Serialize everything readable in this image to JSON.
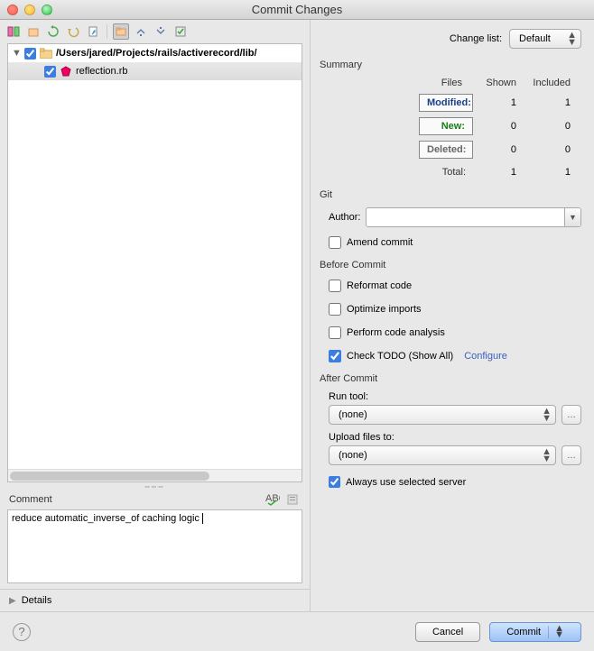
{
  "window": {
    "title": "Commit Changes"
  },
  "changeList": {
    "label": "Change list:",
    "value": "Default"
  },
  "tree": {
    "rootPath": "/Users/jared/Projects/rails/activerecord/lib/",
    "file": "reflection.rb"
  },
  "comment": {
    "label": "Comment",
    "text": "reduce automatic_inverse_of caching logic"
  },
  "summary": {
    "title": "Summary",
    "headers": {
      "files": "Files",
      "shown": "Shown",
      "included": "Included"
    },
    "rows": {
      "modified": {
        "label": "Modified:",
        "shown": "1",
        "included": "1"
      },
      "new": {
        "label": "New:",
        "shown": "0",
        "included": "0"
      },
      "deleted": {
        "label": "Deleted:",
        "shown": "0",
        "included": "0"
      },
      "total": {
        "label": "Total:",
        "shown": "1",
        "included": "1"
      }
    }
  },
  "git": {
    "title": "Git",
    "authorLabel": "Author:",
    "authorValue": "",
    "amend": "Amend commit"
  },
  "before": {
    "title": "Before Commit",
    "reformat": "Reformat code",
    "optimize": "Optimize imports",
    "analysis": "Perform code analysis",
    "todo": "Check TODO (Show All)",
    "configure": "Configure"
  },
  "after": {
    "title": "After Commit",
    "runTool": "Run tool:",
    "runToolValue": "(none)",
    "upload": "Upload files to:",
    "uploadValue": "(none)",
    "always": "Always use selected server"
  },
  "details": {
    "label": "Details"
  },
  "footer": {
    "cancel": "Cancel",
    "commit": "Commit"
  }
}
